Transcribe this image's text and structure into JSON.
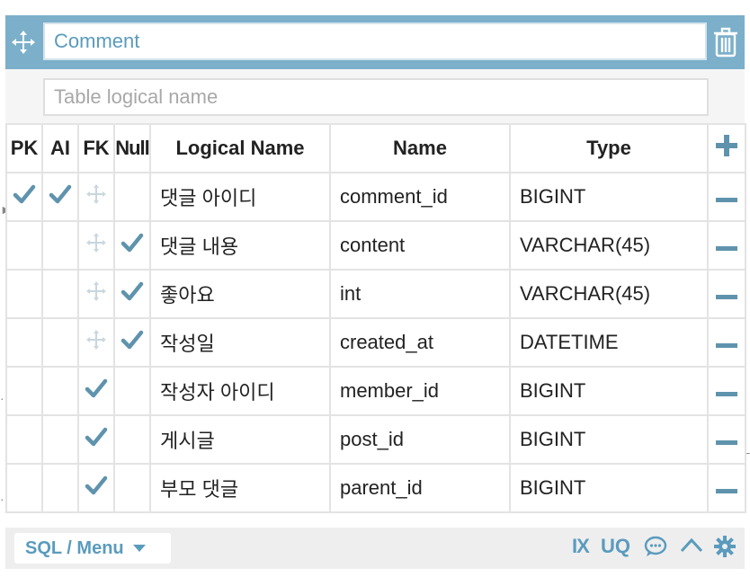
{
  "table": {
    "title_value": "",
    "title_placeholder": "Comment",
    "logical_value": "",
    "logical_placeholder": "Table logical name"
  },
  "columns_header": {
    "pk": "PK",
    "ai": "AI",
    "fk": "FK",
    "null": "Null",
    "logical_name": "Logical Name",
    "name": "Name",
    "type": "Type"
  },
  "rows": [
    {
      "pk": true,
      "ai": true,
      "fk": false,
      "nullable": false,
      "logical_name": "댓글 아이디",
      "name": "comment_id",
      "type": "BIGINT"
    },
    {
      "pk": false,
      "ai": false,
      "fk": false,
      "nullable": true,
      "logical_name": "댓글 내용",
      "name": "content",
      "type": "VARCHAR(45)"
    },
    {
      "pk": false,
      "ai": false,
      "fk": false,
      "nullable": true,
      "logical_name": "좋아요",
      "name": "int",
      "type": "VARCHAR(45)"
    },
    {
      "pk": false,
      "ai": false,
      "fk": false,
      "nullable": true,
      "logical_name": "작성일",
      "name": "created_at",
      "type": "DATETIME"
    },
    {
      "pk": false,
      "ai": false,
      "fk": true,
      "nullable": false,
      "logical_name": "작성자 아이디",
      "name": "member_id",
      "type": "BIGINT"
    },
    {
      "pk": false,
      "ai": false,
      "fk": true,
      "nullable": false,
      "logical_name": "게시글",
      "name": "post_id",
      "type": "BIGINT"
    },
    {
      "pk": false,
      "ai": false,
      "fk": true,
      "nullable": false,
      "logical_name": "부모 댓글",
      "name": "parent_id",
      "type": "BIGINT"
    }
  ],
  "footer": {
    "sql_menu_label": "SQL / Menu",
    "ix_label": "IX",
    "uq_label": "UQ"
  },
  "icons": {
    "move": "move-icon",
    "trash": "trash-icon",
    "add": "plus-icon",
    "remove": "minus-icon",
    "check": "check-icon",
    "comment": "comment-icon",
    "collapse": "chevron-up-icon",
    "settings": "gear-icon"
  },
  "colors": {
    "header_bg": "#7bafca",
    "accent": "#5a9bbd",
    "check": "#5f93ad",
    "muted_move": "#c9d6de"
  }
}
